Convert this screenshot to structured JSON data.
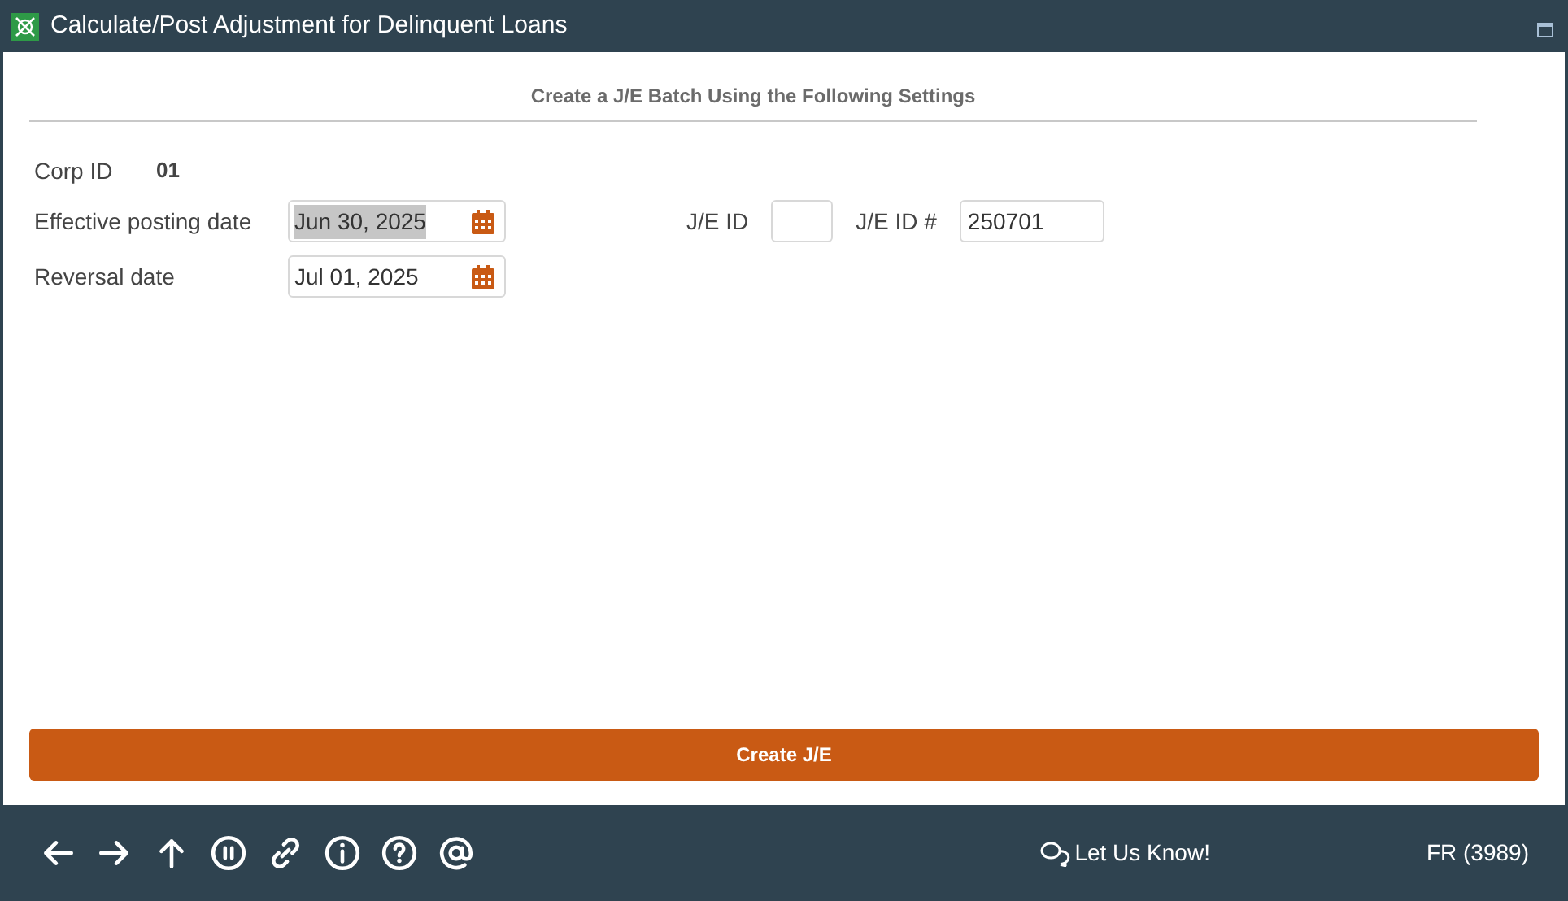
{
  "window": {
    "title": "Calculate/Post Adjustment for Delinquent Loans"
  },
  "section_title": "Create a J/E Batch Using the Following Settings",
  "corp": {
    "label": "Corp ID",
    "value": "01"
  },
  "date_fields": [
    {
      "label": "Effective posting date",
      "value": "Jun 30, 2025",
      "text_selected": true
    },
    {
      "label": "Reversal date",
      "value": "Jul 01, 2025",
      "text_selected": false
    }
  ],
  "je_fields": [
    {
      "label": "J/E ID",
      "kind": "short"
    },
    {
      "label": "J/E ID #",
      "value": "250701",
      "kind": "long"
    }
  ],
  "primary_button": "Create J/E",
  "footer": {
    "feedback": "Let Us Know!",
    "user": "FR (3989)"
  }
}
